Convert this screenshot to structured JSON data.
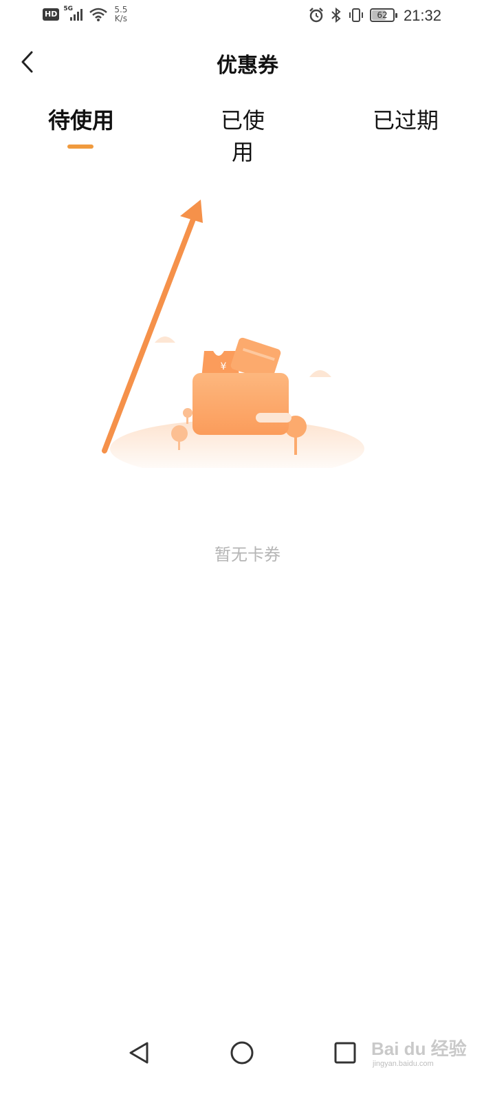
{
  "status_bar": {
    "hd_badge": "HD",
    "network_type": "5G",
    "net_speed_value": "5.5",
    "net_speed_unit": "K/s",
    "battery_level": "62",
    "battery_fraction": 0.62,
    "time": "21:32",
    "icons": [
      "signal-icon",
      "wifi-icon",
      "alarm-icon",
      "bluetooth-icon",
      "vibrate-icon",
      "battery-icon"
    ]
  },
  "header": {
    "title": "优惠券",
    "back_icon": "chevron-left-icon"
  },
  "tabs": [
    {
      "label": "待使用",
      "active": true
    },
    {
      "label": "已使用",
      "active": false
    },
    {
      "label": "已过期",
      "active": false
    }
  ],
  "colors": {
    "accent": "#f09a3e",
    "illustration": "#fbae72",
    "empty_text": "#b5b5b5"
  },
  "empty_state": {
    "text": "暂无卡券",
    "illustration_icon": "wallet-coupon-illustration",
    "currency_symbol": "¥"
  },
  "nav_bar": {
    "icons": [
      "back-triangle-icon",
      "home-circle-icon",
      "recent-square-icon"
    ]
  },
  "watermark": {
    "text": "Bai du 经验",
    "subtext": "jingyan.baidu.com"
  }
}
